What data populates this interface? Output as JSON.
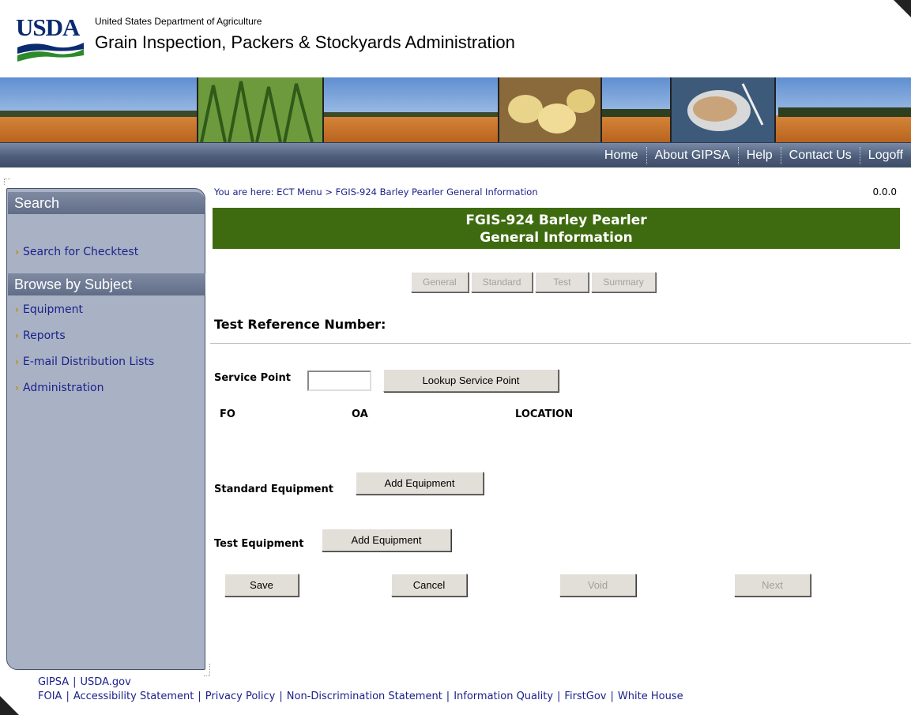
{
  "header": {
    "logo_text": "USDA",
    "department": "United States Department of Agriculture",
    "agency": "Grain Inspection, Packers & Stockyards Administration"
  },
  "nav": {
    "items": [
      "Home",
      "About GIPSA",
      "Help",
      "Contact Us",
      "Logoff"
    ]
  },
  "sidebar": {
    "search_header": "Search",
    "search_link": "Search for Checktest",
    "browse_header": "Browse by Subject",
    "links": [
      "Equipment",
      "Reports",
      "E-mail Distribution Lists",
      "Administration"
    ]
  },
  "main": {
    "breadcrumb": "You are here: ECT Menu > FGIS-924 Barley Pearler General Information",
    "version": "0.0.0",
    "title_line1": "FGIS-924 Barley Pearler",
    "title_line2": "General Information",
    "tabs": [
      "General",
      "Standard",
      "Test",
      "Summary"
    ],
    "test_ref_label": "Test Reference Number:",
    "service_point_label": "Service Point",
    "service_point_value": "",
    "lookup_button": "Lookup Service Point",
    "columns": [
      "FO",
      "OA",
      "LOCATION"
    ],
    "standard_equipment_label": "Standard Equipment",
    "test_equipment_label": "Test Equipment",
    "add_equipment_button": "Add Equipment",
    "save_button": "Save",
    "cancel_button": "Cancel",
    "void_button": "Void",
    "next_button": "Next"
  },
  "footer": {
    "line1": [
      "GIPSA",
      "USDA.gov"
    ],
    "line2": [
      "FOIA",
      "Accessibility Statement",
      "Privacy Policy",
      "Non-Discrimination Statement",
      "Information Quality",
      "FirstGov",
      "White House"
    ]
  },
  "colors": {
    "title_bar": "#3f6b10",
    "navbar": "#4d5e7b",
    "sidebar": "#a9b2c4",
    "link": "#1a1f8a"
  }
}
